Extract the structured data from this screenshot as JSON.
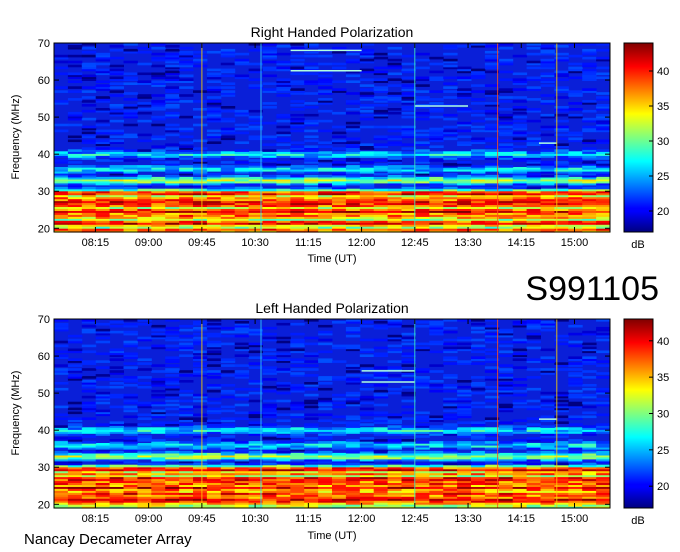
{
  "station_label": "S991105",
  "footer_label": "Nancay Decameter Array",
  "chart_data": [
    {
      "type": "heatmap",
      "title": "Right Handed Polarization",
      "xlabel": "Time (UT)",
      "ylabel": "Frequency (MHz)",
      "x_ticks": [
        "08:15",
        "09:00",
        "09:45",
        "10:30",
        "11:15",
        "12:00",
        "12:45",
        "13:30",
        "14:15",
        "15:00"
      ],
      "y_ticks": [
        20,
        30,
        40,
        50,
        60,
        70
      ],
      "ylim": [
        19,
        70
      ],
      "colorbar": {
        "label": "dB",
        "ticks": [
          20,
          25,
          30,
          35,
          40
        ],
        "range": [
          17,
          44
        ]
      },
      "colormap": "jet",
      "features": {
        "bright_bands_mhz": [
          21.5,
          24.5,
          27,
          29.5,
          33,
          36,
          40
        ],
        "narrowband_lines": [
          {
            "freq": 68,
            "time_from": "11:00",
            "time_to": "12:00"
          },
          {
            "freq": 62.5,
            "time_from": "11:00",
            "time_to": "12:00"
          },
          {
            "freq": 53,
            "time_from": "12:45",
            "time_to": "13:30"
          },
          {
            "freq": 43,
            "time_from": "14:30",
            "time_to": "14:45"
          }
        ],
        "vertical_interference_times": [
          "09:45",
          "10:35",
          "12:45",
          "13:55",
          "14:45"
        ]
      }
    },
    {
      "type": "heatmap",
      "title": "Left Handed Polarization",
      "xlabel": "Time (UT)",
      "ylabel": "Frequency (MHz)",
      "x_ticks": [
        "08:15",
        "09:00",
        "09:45",
        "10:30",
        "11:15",
        "12:00",
        "12:45",
        "13:30",
        "14:15",
        "15:00"
      ],
      "y_ticks": [
        20,
        30,
        40,
        50,
        60,
        70
      ],
      "ylim": [
        19,
        70
      ],
      "colorbar": {
        "label": "dB",
        "ticks": [
          20,
          25,
          30,
          35,
          40
        ],
        "range": [
          17,
          43
        ]
      },
      "colormap": "jet",
      "features": {
        "bright_bands_mhz": [
          21.5,
          24.5,
          27,
          29.5,
          33,
          36,
          40
        ],
        "narrowband_lines": [
          {
            "freq": 56,
            "time_from": "12:00",
            "time_to": "12:45"
          },
          {
            "freq": 53,
            "time_from": "12:00",
            "time_to": "12:45"
          },
          {
            "freq": 43,
            "time_from": "14:30",
            "time_to": "14:45"
          }
        ],
        "vertical_interference_times": [
          "09:45",
          "10:35",
          "12:45",
          "13:55",
          "14:45"
        ]
      }
    }
  ]
}
